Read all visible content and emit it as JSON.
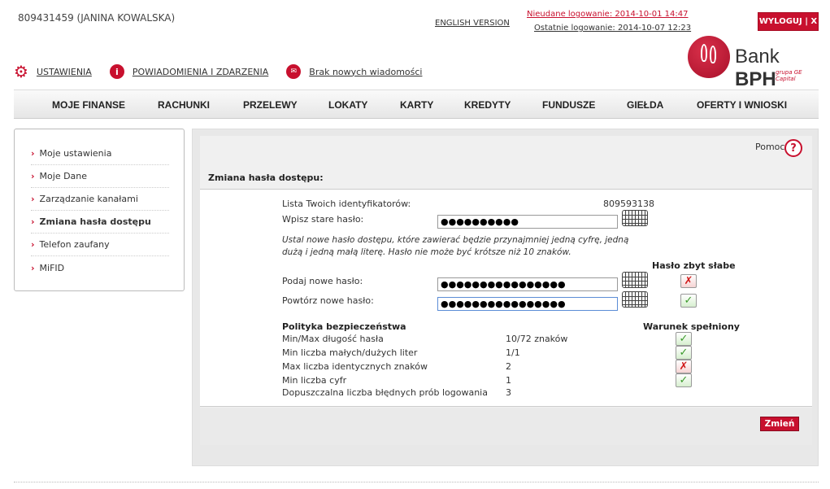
{
  "header": {
    "user": "809431459 (JANINA KOWALSKA)",
    "english": "ENGLISH VERSION",
    "failed_login": "Nieudane logowanie: 2014-10-01 14:47",
    "last_login": "Ostatnie logowanie: 2014-10-07 12:23",
    "logout": "WYLOGUJ | X",
    "brand_left": "Bank",
    "brand_right": "BPH",
    "brand_sub": "grupa GE Capital"
  },
  "toplinks": {
    "settings": "USTAWIENIA",
    "notifications": "POWIADOMIENIA I ZDARZENIA",
    "messages": "Brak nowych wiadomości"
  },
  "menu": [
    "MOJE FINANSE",
    "RACHUNKI",
    "PRZELEWY",
    "LOKATY",
    "KARTY",
    "KREDYTY",
    "FUNDUSZE",
    "GIEŁDA",
    "OFERTY I WNIOSKI"
  ],
  "sidebar": [
    {
      "label": "Moje ustawienia",
      "active": false
    },
    {
      "label": "Moje Dane",
      "active": false
    },
    {
      "label": "Zarządzanie kanałami",
      "active": false
    },
    {
      "label": "Zmiana hasła dostępu",
      "active": true
    },
    {
      "label": "Telefon zaufany",
      "active": false
    },
    {
      "label": "MiFID",
      "active": false
    }
  ],
  "panel": {
    "help": "Pomoc",
    "help_icon": "?",
    "title": "Zmiana hasła dostępu:",
    "ids_label": "Lista Twoich identyfikatorów:",
    "ids_value": "809593138",
    "old_pw_label": "Wpisz stare hasło:",
    "old_pw_value": "●●●●●●●●●●",
    "hint": "Ustal nowe hasło dostępu, które zawierać będzie przynajmniej jedną cyfrę, jedną dużą i jedną małą literę. Hasło nie może być krótsze niż 10 znaków.",
    "strength": "Hasło zbyt słabe",
    "new_pw_label": "Podaj nowe hasło:",
    "new_pw_value": "●●●●●●●●●●●●●●●●",
    "repeat_pw_label": "Powtórz nowe hasło:",
    "repeat_pw_value": "●●●●●●●●●●●●●●●●",
    "policy_head": "Polityka bezpieczeństwa",
    "condition_head": "Warunek spełniony",
    "policy": [
      {
        "label": "Min/Max długość hasła",
        "value": "10/72 znaków",
        "ok": true
      },
      {
        "label": "Min liczba małych/dużych liter",
        "value": "1/1",
        "ok": true
      },
      {
        "label": "Max liczba identycznych znaków",
        "value": "2",
        "ok": false
      },
      {
        "label": "Min liczba cyfr",
        "value": "1",
        "ok": true
      },
      {
        "label": "Dopuszczalna liczba błędnych prób logowania",
        "value": "3",
        "ok": null
      }
    ],
    "submit": "Zmień"
  },
  "colors": {
    "brand": "#c8102e",
    "ok": "#3a9a2a"
  }
}
